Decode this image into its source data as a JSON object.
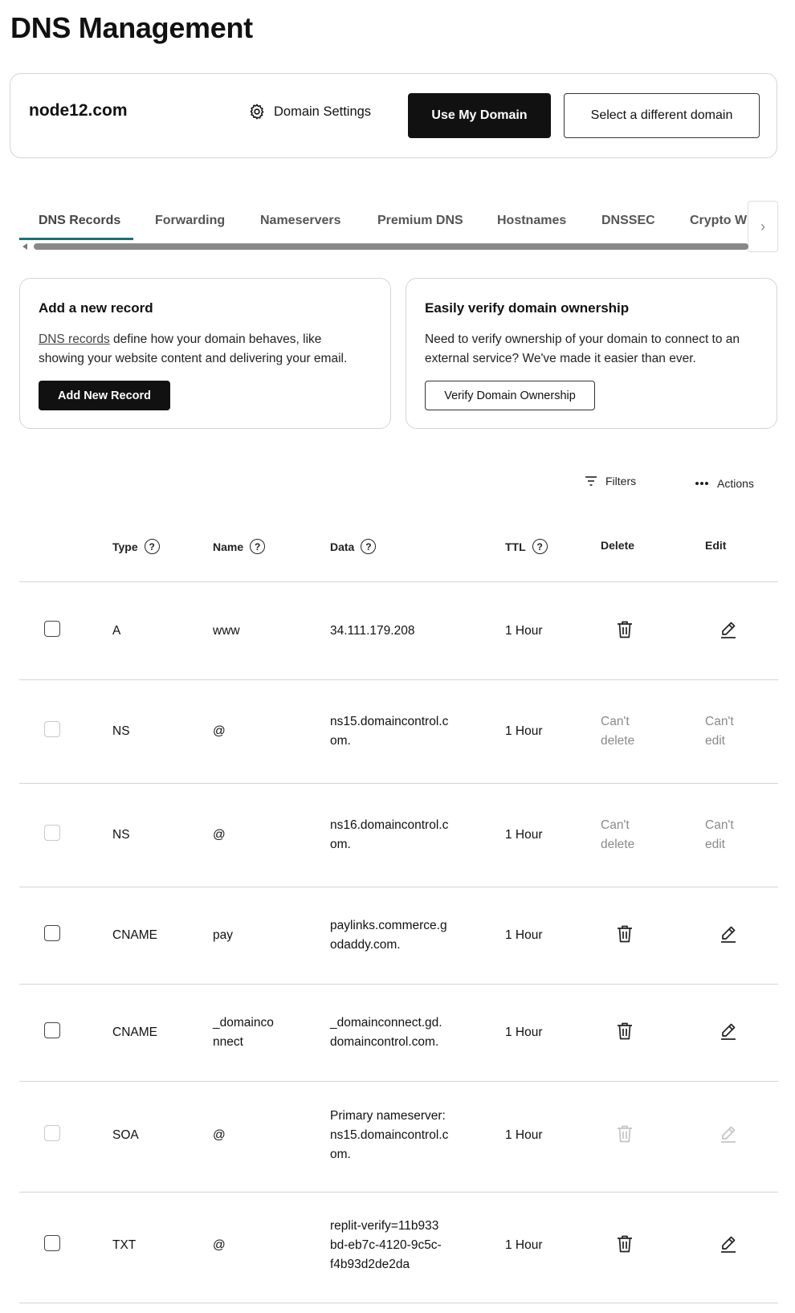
{
  "page": {
    "title": "DNS Management"
  },
  "domain_card": {
    "domain": "node12.com",
    "settings_label": "Domain Settings",
    "primary_button": "Use My Domain",
    "secondary_button": "Select a different domain"
  },
  "tabs": [
    "DNS Records",
    "Forwarding",
    "Nameservers",
    "Premium DNS",
    "Hostnames",
    "DNSSEC",
    "Crypto W"
  ],
  "active_tab": "DNS Records",
  "cards": {
    "add_record": {
      "title": "Add a new record",
      "link_text": "DNS records",
      "text_line1": " define how your domain behaves, like",
      "text_line2": "showing your website content and delivering your email.",
      "button": "Add New Record"
    },
    "verify": {
      "title": "Easily verify domain ownership",
      "text_line1": "Need to verify ownership of your domain to connect to an",
      "text_line2": "external service? We've made it easier than ever.",
      "button": "Verify Domain Ownership"
    }
  },
  "toolbar": {
    "filters": "Filters",
    "actions": "Actions"
  },
  "table": {
    "headers": {
      "type": "Type",
      "name": "Name",
      "data": "Data",
      "ttl": "TTL",
      "delete": "Delete",
      "edit": "Edit"
    },
    "rows": [
      {
        "type": "A",
        "name": [
          "www"
        ],
        "data": [
          "34.111.179.208"
        ],
        "ttl": "1 Hour",
        "editable": true,
        "checkbox_enabled": true
      },
      {
        "type": "NS",
        "name": [
          "@"
        ],
        "data": [
          "ns15.domaincontrol.c",
          "om."
        ],
        "ttl": "1 Hour",
        "editable": false,
        "checkbox_enabled": false,
        "cant_delete": [
          "Can't",
          "delete"
        ],
        "cant_edit": [
          "Can't",
          "edit"
        ]
      },
      {
        "type": "NS",
        "name": [
          "@"
        ],
        "data": [
          "ns16.domaincontrol.c",
          "om."
        ],
        "ttl": "1 Hour",
        "editable": false,
        "checkbox_enabled": false,
        "cant_delete": [
          "Can't",
          "delete"
        ],
        "cant_edit": [
          "Can't",
          "edit"
        ]
      },
      {
        "type": "CNAME",
        "name": [
          "pay"
        ],
        "data": [
          "paylinks.commerce.g",
          "odaddy.com."
        ],
        "ttl": "1 Hour",
        "editable": true,
        "checkbox_enabled": true
      },
      {
        "type": "CNAME",
        "name": [
          "_domainco",
          "nnect"
        ],
        "data": [
          "_domainconnect.gd.",
          "domaincontrol.com."
        ],
        "ttl": "1 Hour",
        "editable": true,
        "checkbox_enabled": true
      },
      {
        "type": "SOA",
        "name": [
          "@"
        ],
        "data": [
          "Primary nameserver:",
          "ns15.domaincontrol.c",
          "om."
        ],
        "ttl": "1 Hour",
        "editable": "disabled",
        "checkbox_enabled": false
      },
      {
        "type": "TXT",
        "name": [
          "@"
        ],
        "data": [
          "replit-verify=11b933",
          "bd-eb7c-4120-9c5c-",
          "f4b93d2de2da"
        ],
        "ttl": "1 Hour",
        "editable": true,
        "checkbox_enabled": true
      }
    ]
  },
  "colors": {
    "accent": "#1c6f78",
    "primary_button": "#111111",
    "muted_text": "#8a8a8a",
    "border": "#d4d4d4"
  }
}
